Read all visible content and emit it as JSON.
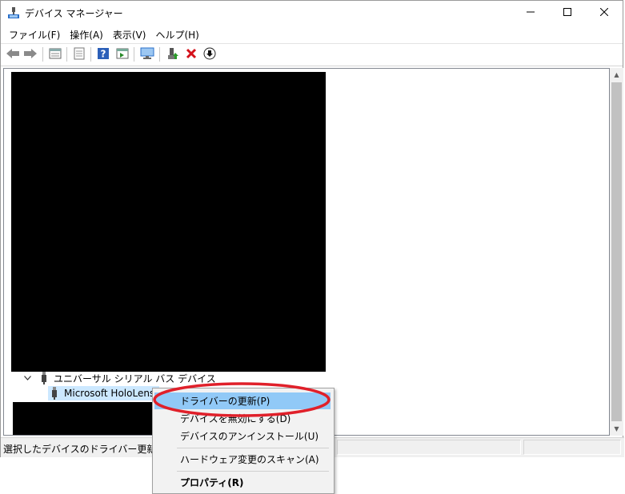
{
  "window": {
    "title": "デバイス マネージャー",
    "icons": [
      "device-manager-icon",
      "minimize-icon",
      "maximize-icon",
      "close-icon"
    ]
  },
  "menu": [
    "ファイル(F)",
    "操作(A)",
    "表示(V)",
    "ヘルプ(H)"
  ],
  "toolbar": {
    "buttons": [
      "back-arrow-icon",
      "forward-arrow-icon",
      "view-list-icon",
      "properties-sheet-icon",
      "help-icon",
      "driver-update-icon",
      "monitor-scan-icon",
      "enable-device-icon",
      "uninstall-x-icon",
      "disable-download-icon"
    ]
  },
  "tree": {
    "category_label": "ユニバーサル シリアル バス デバイス",
    "device_label": "Microsoft HoloLens"
  },
  "context_menu": {
    "items": [
      "ドライバーの更新(P)",
      "デバイスを無効にする(D)",
      "デバイスのアンインストール(U)",
      "ハードウェア変更のスキャン(A)",
      "プロパティ(R)"
    ]
  },
  "status": {
    "text": "選択したデバイスのドライバー更新ウィザード"
  },
  "colors": {
    "highlight_menu": "#91c9f7",
    "selected_row": "#cce8ff",
    "annotation_ellipse": "#e0202a",
    "redacted": "#000000"
  }
}
